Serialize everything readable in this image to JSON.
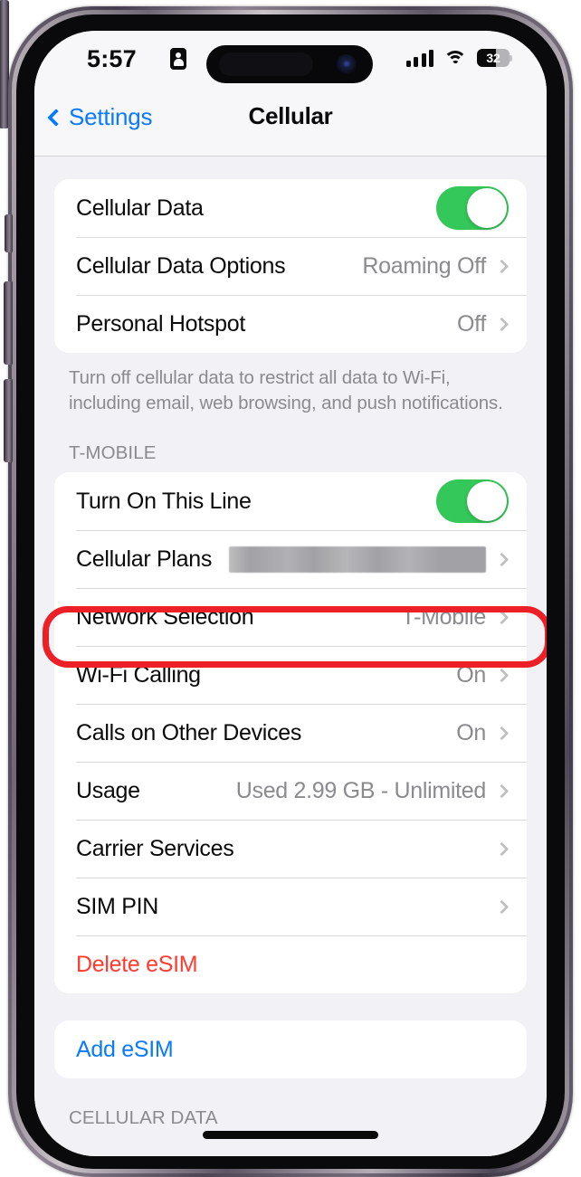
{
  "status_bar": {
    "time": "5:57",
    "id_icon": "person-card-icon",
    "signal_icon": "cellular-signal-icon",
    "wifi_icon": "wifi-icon",
    "battery_percent": "32",
    "battery_level": 32
  },
  "nav": {
    "back_label": "Settings",
    "back_icon": "chevron-left-icon",
    "title": "Cellular"
  },
  "groups": {
    "data_group": [
      {
        "label": "Cellular Data",
        "control": "toggle",
        "toggle_on": true
      },
      {
        "label": "Cellular Data Options",
        "value": "Roaming Off",
        "control": "chevron"
      },
      {
        "label": "Personal Hotspot",
        "value": "Off",
        "control": "chevron"
      }
    ],
    "data_group_footnote": "Turn off cellular data to restrict all data to Wi‑Fi, including email, web browsing, and push notifications.",
    "line_section_header": "T-MOBILE",
    "line_group": [
      {
        "label": "Turn On This Line",
        "control": "toggle",
        "toggle_on": true
      },
      {
        "label": "Cellular Plans",
        "value": "",
        "redacted": true,
        "control": "chevron"
      },
      {
        "label": "Network Selection",
        "value": "T-Mobile",
        "control": "chevron",
        "highlighted": true
      },
      {
        "label": "Wi-Fi Calling",
        "value": "On",
        "control": "chevron"
      },
      {
        "label": "Calls on Other Devices",
        "value": "On",
        "control": "chevron"
      },
      {
        "label": "Usage",
        "value": "Used 2.99 GB - Unlimited",
        "control": "chevron"
      },
      {
        "label": "Carrier Services",
        "value": "",
        "control": "chevron"
      },
      {
        "label": "SIM PIN",
        "value": "",
        "control": "chevron"
      },
      {
        "label": "Delete eSIM",
        "value": "",
        "control": "none",
        "style": "destructive"
      }
    ],
    "add_group": [
      {
        "label": "Add eSIM",
        "control": "none",
        "style": "accent"
      }
    ],
    "bottom_section_header": "CELLULAR DATA"
  },
  "colors": {
    "accent_blue": "#0a7aff",
    "toggle_green": "#34c759",
    "destructive_red": "#ff3b30",
    "annotation_red": "#ee2027",
    "value_gray": "#8a8a8f"
  }
}
